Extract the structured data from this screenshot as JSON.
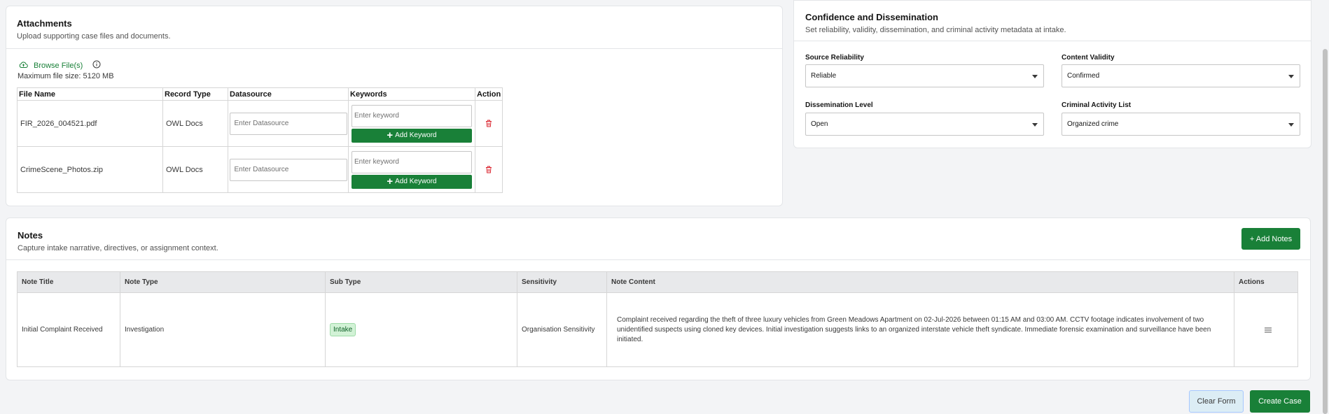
{
  "attachments": {
    "title": "Attachments",
    "subtitle": "Upload supporting case files and documents.",
    "browse_label": "Browse File(s)",
    "max_size": "Maximum file size: 5120 MB",
    "columns": [
      "File Name",
      "Record Type",
      "Datasource",
      "Keywords",
      "Action"
    ],
    "rows": [
      {
        "file_name": "FIR_2026_004521.pdf",
        "record_type": "OWL Docs",
        "datasource_placeholder": "Enter Datasource",
        "keyword_placeholder": "Enter keyword",
        "add_keyword": "Add Keyword"
      },
      {
        "file_name": "CrimeScene_Photos.zip",
        "record_type": "OWL Docs",
        "datasource_placeholder": "Enter Datasource",
        "keyword_placeholder": "Enter keyword",
        "add_keyword": "Add Keyword"
      }
    ]
  },
  "confidence": {
    "title": "Confidence and Dissemination",
    "subtitle": "Set reliability, validity, dissemination, and criminal activity metadata at intake.",
    "fields": {
      "source_reliability": {
        "label": "Source Reliability",
        "value": "Reliable"
      },
      "content_validity": {
        "label": "Content Validity",
        "value": "Confirmed"
      },
      "dissemination_level": {
        "label": "Dissemination Level",
        "value": "Open"
      },
      "criminal_activity": {
        "label": "Criminal Activity List",
        "value": "Organized crime"
      }
    }
  },
  "notes": {
    "title": "Notes",
    "subtitle": "Capture intake narrative, directives, or assignment context.",
    "add_label": "+ Add Notes",
    "columns": [
      "Note Title",
      "Note Type",
      "Sub Type",
      "Sensitivity",
      "Note Content",
      "Actions"
    ],
    "rows": [
      {
        "title": "Initial Complaint Received",
        "type": "Investigation",
        "sub_type": "Intake",
        "sensitivity": "Organisation Sensitivity",
        "content": "Complaint received regarding the theft of three luxury vehicles from Green Meadows Apartment on 02-Jul-2026 between 01:15 AM and 03:00 AM. CCTV footage indicates involvement of two unidentified suspects using cloned key devices. Initial investigation suggests links to an organized interstate vehicle theft syndicate. Immediate forensic examination and surveillance have been initiated."
      }
    ]
  },
  "footer": {
    "clear_label": "Clear Form",
    "create_label": "Create Case"
  },
  "colors": {
    "accent_green": "#198038",
    "danger_red": "#da1e28",
    "tag_green_bg": "#d2f2d6"
  },
  "icons": {
    "browse": "cloud-upload-icon",
    "info": "info-icon",
    "delete": "trash-icon",
    "plus": "plus-icon",
    "row_menu": "menu-icon",
    "select_caret": "chevron-down-icon"
  }
}
